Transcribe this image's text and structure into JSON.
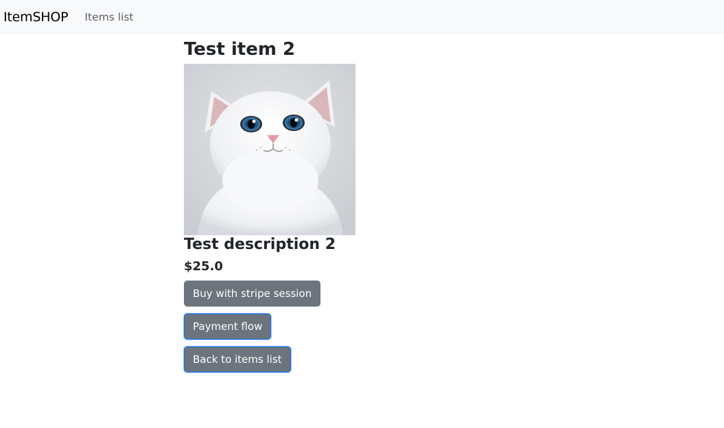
{
  "navbar": {
    "brand": "ItemSHOP",
    "links": [
      "Items list"
    ]
  },
  "item": {
    "title": "Test item 2",
    "image_alt": "white cat",
    "description": "Test description 2",
    "price": "$25.0"
  },
  "actions": {
    "buy_stripe_session": "Buy with stripe session",
    "payment_flow": "Payment flow",
    "back_to_list": "Back to items list"
  },
  "colors": {
    "navbar_bg": "#f8f9fa",
    "button_bg": "#6c757d",
    "focus_border": "#0d6efd"
  }
}
